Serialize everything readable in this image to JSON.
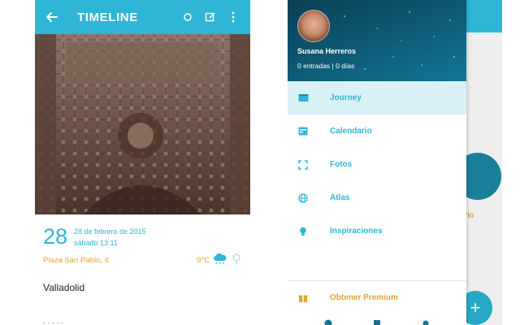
{
  "left_screen": {
    "appbar": {
      "title": "TIMELINE",
      "color": "#2fb6d6",
      "back_icon": "arrow-left-icon",
      "actions": [
        "circle-icon",
        "edit-icon",
        "more-vert-icon"
      ]
    },
    "entry": {
      "day": "28",
      "date": "28 de febrero de 2015",
      "time": "sábado 13:11",
      "location": "Plaza San Pablo, 4",
      "temperature": "9°C",
      "weather_icons": [
        "rain-cloud-icon",
        "thermometer-icon"
      ],
      "text": "Valladolid",
      "below_text": "- -  - - -"
    }
  },
  "right_screen": {
    "drawer": {
      "user_name": "Susana Herreros",
      "user_stats": "0 entradas | 0 días",
      "items": [
        {
          "label": "Journey",
          "icon": "journey-icon",
          "active": true
        },
        {
          "label": "Calendario",
          "icon": "calendar-icon",
          "active": false
        },
        {
          "label": "Fotos",
          "icon": "photo-frame-icon",
          "active": false
        },
        {
          "label": "Atlas",
          "icon": "globe-icon",
          "active": false
        },
        {
          "label": "Inspiraciones",
          "icon": "lightbulb-icon",
          "active": false
        }
      ],
      "premium_label": "Obtener Premium",
      "premium_icon": "gift-icon"
    },
    "background": {
      "partial_label": "rio",
      "fab_label": "+"
    }
  },
  "colors": {
    "accent": "#2fb6d6",
    "secondary": "#e3a13b",
    "active_bg": "#d8f1f7"
  }
}
